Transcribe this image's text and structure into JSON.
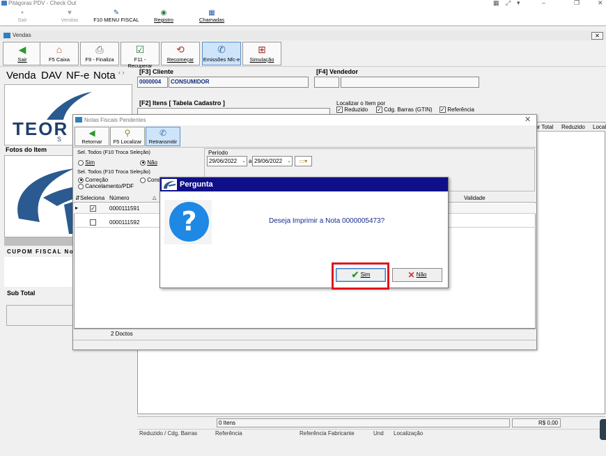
{
  "app": {
    "title": "Pitágoras PDV - Check Out"
  },
  "top_toolbar": [
    {
      "label": "Sair",
      "icon": "exit-icon",
      "enabled": false
    },
    {
      "label": "Vendas",
      "icon": "cart-icon",
      "enabled": false
    },
    {
      "label": "F10 MENU FISCAL",
      "icon": "fiscal-menu-icon",
      "enabled": true
    },
    {
      "label": "Registro",
      "icon": "register-icon",
      "enabled": true
    },
    {
      "label": "Chamadas",
      "icon": "calls-icon",
      "enabled": true
    }
  ],
  "vendas": {
    "title": "Vendas",
    "toolbar": [
      {
        "label": "Sair",
        "icon": "exit-arrow-icon"
      },
      {
        "label": "F5 Caixa",
        "icon": "house-icon"
      },
      {
        "label": "F9 - Finaliza",
        "icon": "printer-icon"
      },
      {
        "label": "F11 - Recuperar",
        "icon": "checklist-icon"
      },
      {
        "label": "Recomeçar",
        "icon": "restart-icon"
      },
      {
        "label": "Emissões Nfc-e",
        "icon": "nfce-icon"
      },
      {
        "label": "Simulação",
        "icon": "simulation-icon"
      }
    ],
    "tabs": [
      "Venda",
      "DAV",
      "NF-e",
      "Nota"
    ],
    "logo_text": "TEOR",
    "logo_sub": "S",
    "fotos_label": "Fotos do Item",
    "cupom_label": "CUPOM FISCAL No.",
    "subtotal_label": "Sub Total",
    "cliente_label": "[F3] Cliente",
    "cliente_code": "0000004",
    "cliente_name": "CONSUMIDOR",
    "vendedor_label": "[F4] Vendedor",
    "items_label": "[F2] Itens [ Tabela Cadastro ]",
    "localizar": {
      "label": "Localizar o Item por",
      "options": [
        {
          "label": "Reduzido",
          "checked": true
        },
        {
          "label": "Cdg. Barras (GTIN)",
          "checked": true
        },
        {
          "label": "Referência",
          "checked": true
        }
      ]
    },
    "grid_columns": [
      "alor Total",
      "Reduzido",
      "Locali"
    ],
    "status": {
      "itens": "0 Itens",
      "total": "R$ 0,00"
    },
    "bottom_columns": [
      "Reduzido / Cdg. Barras",
      "Referência",
      "Referência Fabricante",
      "Und",
      "Localização"
    ]
  },
  "notas": {
    "title": "Notas Fiscais Pendentes",
    "toolbar": [
      {
        "label": "Retornar",
        "icon": "return-arrow-icon"
      },
      {
        "label": "F5 Localizar",
        "icon": "binoculars-icon"
      },
      {
        "label": "Retransmitir",
        "icon": "retransmit-icon"
      }
    ],
    "sel_todos_1": "Sel. Todos (F10 Troca Seleção)",
    "radio_sim": "Sim",
    "radio_nao": "Não",
    "radio_nao_selected": true,
    "sel_todos_2": "Sel. Todos (F10 Troca Seleção)",
    "radio_correcao": "Correção",
    "radio_cons": "Cons",
    "radio_cancel": "Cancelamento/PDF",
    "periodo_label": "Período",
    "date_from": "29/06/2022",
    "date_sep": "a",
    "date_to": "29/06/2022",
    "columns": [
      "Seleciona",
      "Número",
      "Validade"
    ],
    "rows": [
      {
        "numero": "0000111591",
        "selected": true
      },
      {
        "numero": "0000111592",
        "selected": false
      }
    ],
    "footer": "2 Doctos"
  },
  "dialog": {
    "title": "Pergunta",
    "message": "Deseja Imprimir a Nota 0000005473?",
    "icon": "question-icon",
    "yes_label": "Sim",
    "no_label": "Não",
    "highlight_color": "#e0141e"
  }
}
